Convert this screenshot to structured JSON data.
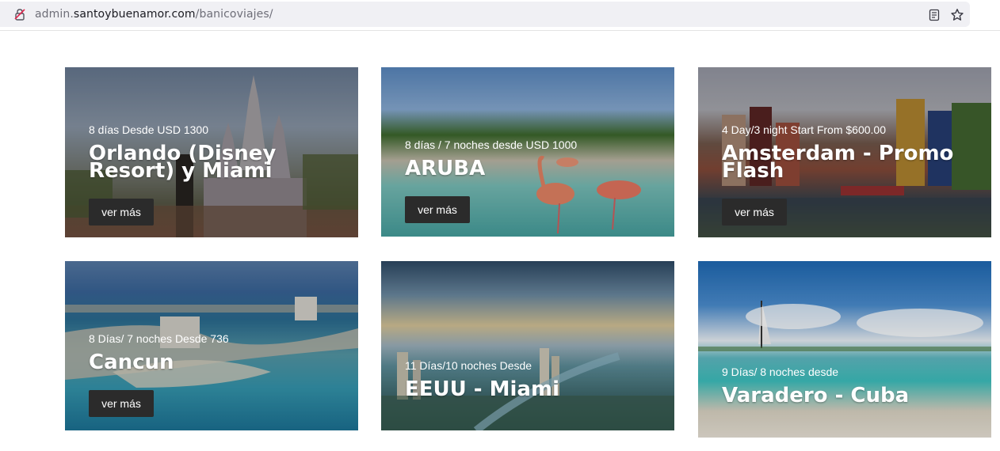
{
  "browser": {
    "url_prefix": "admin.",
    "url_host": "santoybuenamor.com",
    "url_path": "/banicoviajes/"
  },
  "cards": [
    {
      "subtitle": "8 días Desde USD 1300",
      "title": "Orlando (Disney Resort) y Miami",
      "button": "ver más"
    },
    {
      "subtitle": "8 días / 7 noches desde USD 1000",
      "title": "ARUBA",
      "button": "ver más"
    },
    {
      "subtitle": "4 Day/3 night Start From $600.00",
      "title": "Amsterdam - Promo Flash",
      "button": "ver más"
    },
    {
      "subtitle": "8 Días/ 7 noches Desde 736",
      "title": "Cancun",
      "button": "ver más"
    },
    {
      "subtitle": "11 Días/10 noches Desde",
      "title": "EEUU - Miami"
    },
    {
      "subtitle": "9 Días/ 8 noches desde",
      "title": "Varadero - Cuba"
    }
  ]
}
